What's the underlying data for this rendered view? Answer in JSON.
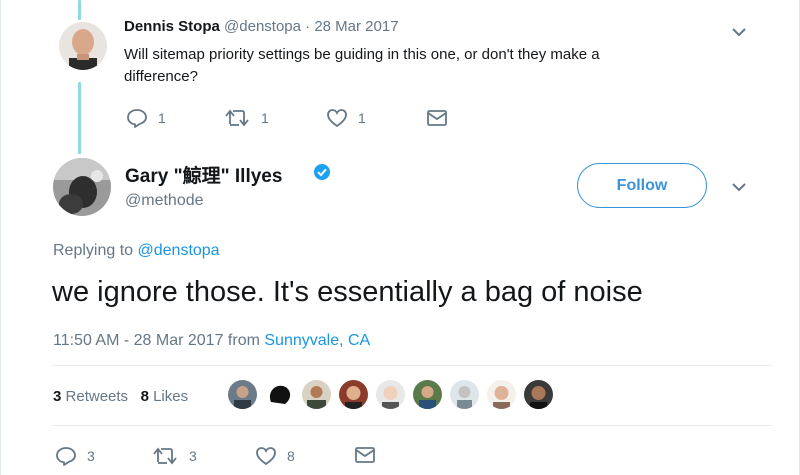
{
  "reply": {
    "name": "Dennis Stopa",
    "handle": "@denstopa",
    "date": "· 28 Mar 2017",
    "text_line1": "Will sitemap priority settings be guiding in this one, or don't they make a",
    "text_line2": "difference?",
    "counts": {
      "replies": "1",
      "retweets": "1",
      "likes": "1"
    }
  },
  "main": {
    "name_latin": "Gary \"",
    "name_cjk": "鯨理",
    "name_end": "\" Illyes",
    "handle": "@methode",
    "follow_label": "Follow",
    "replying_prefix": "Replying to",
    "replying_handle": "@denstopa",
    "text": "we ignore those. It's essentially a bag of noise",
    "time": "11:50 AM - 28 Mar 2017 from",
    "location": "Sunnyvale, CA",
    "stats": {
      "retweets_count": "3",
      "retweets_label": "Retweets",
      "likes_count": "8",
      "likes_label": "Likes"
    },
    "counts": {
      "replies": "3",
      "retweets": "3",
      "likes": "8"
    }
  },
  "colors": {
    "accent": "#1da1f2",
    "link": "#1b95e0",
    "follow_border": "#3b94d9",
    "thread": "#8fd8e8",
    "muted": "#657786"
  },
  "icons": [
    "reply-icon",
    "retweet-icon",
    "like-icon",
    "message-icon",
    "verified-icon",
    "chevron-down-icon"
  ]
}
